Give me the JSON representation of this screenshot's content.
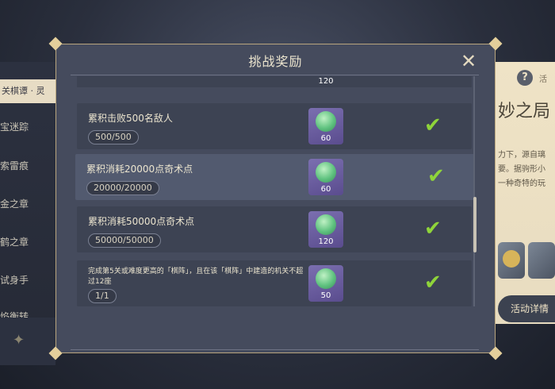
{
  "left_menu": {
    "title": "关棋谭 · 灵",
    "items": [
      {
        "label": "宝迷踪"
      },
      {
        "label": "索雷痕"
      },
      {
        "label": "金之章"
      },
      {
        "label": "鹤之章"
      },
      {
        "label": "试身手"
      },
      {
        "label": "焰衡转"
      }
    ]
  },
  "right_panel": {
    "help_label": "活",
    "title": "妙之局",
    "desc_lines": [
      "力下，源自璃",
      "要。据驹形小",
      "一种奇特的玩"
    ],
    "button_label": "活动详情"
  },
  "modal": {
    "title": "挑战奖励",
    "partial_row_reward": "120",
    "rows": [
      {
        "desc": "累积击败500名敌人",
        "progress": "500/500",
        "reward": "60",
        "completed": true
      },
      {
        "desc": "累积消耗20000点奇术点",
        "progress": "20000/20000",
        "reward": "60",
        "completed": true
      },
      {
        "desc": "累积消耗50000点奇术点",
        "progress": "50000/50000",
        "reward": "120",
        "completed": true
      },
      {
        "desc": "完成第5关或难度更高的「棋阵」，且在该「棋阵」中建造的机关不超过12座",
        "progress": "1/1",
        "reward": "50",
        "completed": true
      }
    ]
  },
  "colors": {
    "accent_gold": "#e4cf9b",
    "check_green": "#8fd43a",
    "reward_purple": "#6a5ca0"
  }
}
